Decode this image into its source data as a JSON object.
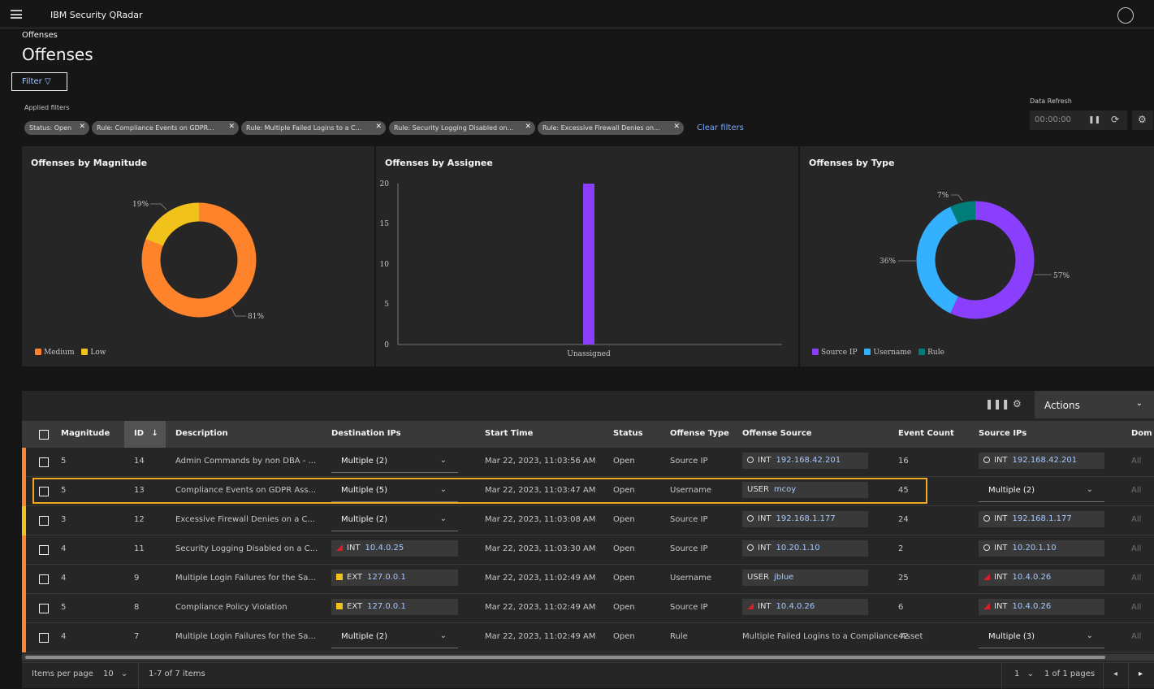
{
  "header": {
    "brand": "IBM Security QRadar"
  },
  "breadcrumb": "Offenses",
  "page_title": "Offenses",
  "filter_button": "Filter",
  "applied_filters": {
    "label": "Applied filters",
    "tags": [
      "Status: Open",
      "Rule: Compliance Events on GDPR...",
      "Rule: Multiple Failed Logins to a C...",
      "Rule: Security Logging Disabled on...",
      "Rule: Excessive Firewall Denies on..."
    ],
    "clear": "Clear filters"
  },
  "data_refresh": {
    "label": "Data Refresh",
    "value": "00:00:00"
  },
  "charts": {
    "magnitude": {
      "title": "Offenses by Magnitude",
      "label_low": "19%",
      "label_medium": "81%",
      "legend": [
        "Medium",
        "Low"
      ],
      "colors": {
        "Medium": "#ff832b",
        "Low": "#f1c21b"
      }
    },
    "assignee": {
      "title": "Offenses by Assignee",
      "yticks": [
        "20",
        "15",
        "10",
        "5",
        "0"
      ],
      "category": "Unassigned",
      "color": "#8a3ffc"
    },
    "type": {
      "title": "Offenses by Type",
      "label_rule": "7%",
      "label_username": "36%",
      "label_source": "57%",
      "legend": [
        "Source IP",
        "Username",
        "Rule"
      ],
      "colors": {
        "Source IP": "#8a3ffc",
        "Username": "#33b1ff",
        "Rule": "#007d79"
      }
    }
  },
  "chart_data": [
    {
      "type": "pie",
      "title": "Offenses by Magnitude",
      "categories": [
        "Medium",
        "Low"
      ],
      "values": [
        81,
        19
      ],
      "unit": "%"
    },
    {
      "type": "bar",
      "title": "Offenses by Assignee",
      "categories": [
        "Unassigned"
      ],
      "values": [
        20
      ],
      "ylim": [
        0,
        20
      ]
    },
    {
      "type": "pie",
      "title": "Offenses by Type",
      "categories": [
        "Source IP",
        "Username",
        "Rule"
      ],
      "values": [
        57,
        36,
        7
      ],
      "unit": "%"
    }
  ],
  "table": {
    "actions": "Actions",
    "columns": {
      "magnitude": "Magnitude",
      "id": "ID",
      "description": "Description",
      "dest_ips": "Destination IPs",
      "start_time": "Start Time",
      "status": "Status",
      "offense_type": "Offense Type",
      "offense_source": "Offense Source",
      "event_count": "Event Count",
      "source_ips": "Source IPs",
      "domain": "Dom"
    },
    "rows": [
      {
        "magnitude": "5",
        "id": "14",
        "description": "Admin Commands by non DBA - ...",
        "dest": {
          "kind": "dropdown",
          "text": "Multiple (2)"
        },
        "start": "Mar 22, 2023, 11:03:56 AM",
        "status": "Open",
        "type": "Source IP",
        "source": {
          "kind": "chip",
          "icon": "circ",
          "tag": "INT",
          "val": "192.168.42.201"
        },
        "count": "16",
        "srcip": {
          "kind": "chip",
          "icon": "circ",
          "tag": "INT",
          "val": "192.168.42.201"
        },
        "dom": "All",
        "sev": "#ff832b"
      },
      {
        "magnitude": "5",
        "id": "13",
        "description": "Compliance Events on GDPR Ass...",
        "dest": {
          "kind": "dropdown",
          "text": "Multiple (5)"
        },
        "start": "Mar 22, 2023, 11:03:47 AM",
        "status": "Open",
        "type": "Username",
        "source": {
          "kind": "chip",
          "icon": "",
          "tag": "USER",
          "val": "mcoy"
        },
        "count": "45",
        "srcip": {
          "kind": "dropdown",
          "text": "Multiple (2)"
        },
        "dom": "All",
        "sev": "#ff832b"
      },
      {
        "magnitude": "3",
        "id": "12",
        "description": "Excessive Firewall Denies on a C...",
        "dest": {
          "kind": "dropdown",
          "text": "Multiple (2)"
        },
        "start": "Mar 22, 2023, 11:03:08 AM",
        "status": "Open",
        "type": "Source IP",
        "source": {
          "kind": "chip",
          "icon": "circ",
          "tag": "INT",
          "val": "192.168.1.177"
        },
        "count": "24",
        "srcip": {
          "kind": "chip",
          "icon": "circ",
          "tag": "INT",
          "val": "192.168.1.177"
        },
        "dom": "All",
        "sev": "#f1c21b"
      },
      {
        "magnitude": "4",
        "id": "11",
        "description": "Security Logging Disabled on a C...",
        "dest": {
          "kind": "chip",
          "icon": "tri",
          "tag": "INT",
          "val": "10.4.0.25"
        },
        "start": "Mar 22, 2023, 11:03:30 AM",
        "status": "Open",
        "type": "Source IP",
        "source": {
          "kind": "chip",
          "icon": "circ",
          "tag": "INT",
          "val": "10.20.1.10"
        },
        "count": "2",
        "srcip": {
          "kind": "chip",
          "icon": "circ",
          "tag": "INT",
          "val": "10.20.1.10"
        },
        "dom": "All",
        "sev": "#ff832b"
      },
      {
        "magnitude": "4",
        "id": "9",
        "description": "Multiple Login Failures for the Sa...",
        "dest": {
          "kind": "chip",
          "icon": "sq",
          "tag": "EXT",
          "val": "127.0.0.1"
        },
        "start": "Mar 22, 2023, 11:02:49 AM",
        "status": "Open",
        "type": "Username",
        "source": {
          "kind": "chip",
          "icon": "",
          "tag": "USER",
          "val": "jblue"
        },
        "count": "25",
        "srcip": {
          "kind": "chip",
          "icon": "tri",
          "tag": "INT",
          "val": "10.4.0.26"
        },
        "dom": "All",
        "sev": "#ff832b"
      },
      {
        "magnitude": "5",
        "id": "8",
        "description": "Compliance Policy Violation",
        "dest": {
          "kind": "chip",
          "icon": "sq",
          "tag": "EXT",
          "val": "127.0.0.1"
        },
        "start": "Mar 22, 2023, 11:02:49 AM",
        "status": "Open",
        "type": "Source IP",
        "source": {
          "kind": "chip",
          "icon": "tri",
          "tag": "INT",
          "val": "10.4.0.26"
        },
        "count": "6",
        "srcip": {
          "kind": "chip",
          "icon": "tri",
          "tag": "INT",
          "val": "10.4.0.26"
        },
        "dom": "All",
        "sev": "#ff832b"
      },
      {
        "magnitude": "4",
        "id": "7",
        "description": "Multiple Login Failures for the Sa...",
        "dest": {
          "kind": "dropdown",
          "text": "Multiple (2)"
        },
        "start": "Mar 22, 2023, 11:02:49 AM",
        "status": "Open",
        "type": "Rule",
        "source": {
          "kind": "text",
          "text": "Multiple Failed Logins to a Compliance Asset"
        },
        "count": "42",
        "srcip": {
          "kind": "dropdown",
          "text": "Multiple (3)"
        },
        "dom": "All",
        "sev": "#ff832b"
      }
    ]
  },
  "pagination": {
    "items_per_page_label": "Items per page",
    "items_per_page": "10",
    "range": "1-7 of 7 items",
    "page": "1",
    "pages": "1 of 1 pages"
  }
}
